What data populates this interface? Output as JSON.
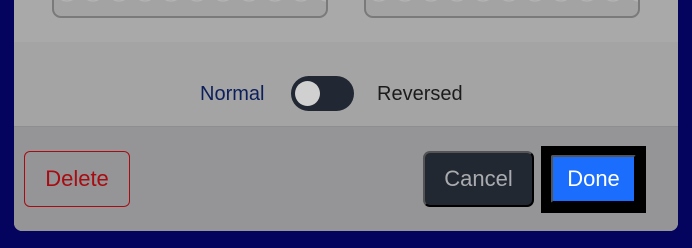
{
  "toggle": {
    "left_label": "Normal",
    "right_label": "Reversed",
    "state": "Normal"
  },
  "footer": {
    "delete_label": "Delete",
    "cancel_label": "Cancel",
    "done_label": "Done"
  },
  "colors": {
    "overlay_background": "#04045e",
    "delete": "#a60c12",
    "cancel_bg": "#222832",
    "done_bg": "#1a6dfd"
  }
}
